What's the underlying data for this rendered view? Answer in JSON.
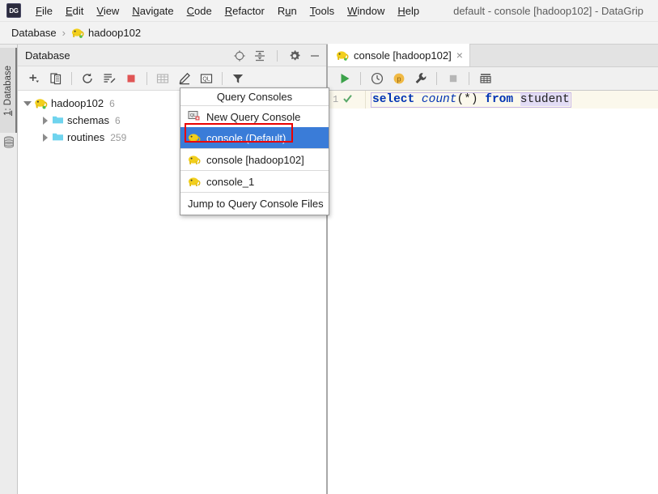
{
  "window": {
    "title": "default - console [hadoop102] - DataGrip",
    "logo": "DG"
  },
  "menubar": {
    "items": [
      {
        "label": "File",
        "mnemonic": "F"
      },
      {
        "label": "Edit",
        "mnemonic": "E"
      },
      {
        "label": "View",
        "mnemonic": "V"
      },
      {
        "label": "Navigate",
        "mnemonic": "N"
      },
      {
        "label": "Code",
        "mnemonic": "C"
      },
      {
        "label": "Refactor",
        "mnemonic": "R"
      },
      {
        "label": "Run",
        "mnemonic": "n"
      },
      {
        "label": "Tools",
        "mnemonic": "T"
      },
      {
        "label": "Window",
        "mnemonic": "W"
      },
      {
        "label": "Help",
        "mnemonic": "H"
      }
    ]
  },
  "breadcrumb": {
    "root": "Database",
    "separator": "›",
    "current": "hadoop102"
  },
  "stripe": {
    "tool_window_label": "1: Database",
    "tool_window_number": "1",
    "db_icon": "database-cylinder-icon"
  },
  "database_panel": {
    "title": "Database",
    "header_actions": [
      {
        "name": "locate-icon",
        "tooltip": "Scroll from Source"
      },
      {
        "name": "collapse-all-icon",
        "tooltip": "Collapse All"
      },
      {
        "name": "gear-icon",
        "tooltip": "Settings"
      },
      {
        "name": "minimize-icon",
        "tooltip": "Hide"
      }
    ],
    "toolbar": [
      {
        "name": "add-icon",
        "tooltip": "New"
      },
      {
        "name": "duplicate-icon",
        "tooltip": "Duplicate"
      },
      {
        "name": "refresh-icon",
        "tooltip": "Refresh"
      },
      {
        "name": "synchronize-icon",
        "tooltip": "Run Script"
      },
      {
        "name": "stop-icon",
        "tooltip": "Stop"
      },
      {
        "name": "table-icon",
        "tooltip": "Open Table Editor"
      },
      {
        "name": "edit-icon",
        "tooltip": "Modify"
      },
      {
        "name": "query-language-icon",
        "tooltip": "QL Console"
      },
      {
        "name": "filter-icon",
        "tooltip": "Filter"
      }
    ],
    "tree": [
      {
        "label": "hadoop102",
        "count": "6",
        "icon": "hive-elephant-icon",
        "expanded": true,
        "level": 0
      },
      {
        "label": "schemas",
        "count": "6",
        "icon": "folder-icon",
        "expanded": false,
        "level": 1
      },
      {
        "label": "routines",
        "count": "259",
        "icon": "folder-icon",
        "expanded": false,
        "level": 1
      }
    ]
  },
  "popup_menu": {
    "title": "Query Consoles",
    "items": [
      {
        "label": "New Query Console",
        "icon": "new-query-console-icon",
        "selected": false
      },
      {
        "label": "console (Default)",
        "icon": "hive-elephant-icon",
        "selected": true
      },
      {
        "label": "console [hadoop102]",
        "icon": "hive-elephant-icon",
        "selected": false
      },
      {
        "label": "console_1",
        "icon": "hive-elephant-icon",
        "selected": false
      }
    ],
    "footer_item": "Jump to Query Console Files",
    "selection_color": "#3a7cd8",
    "highlight_box_color": "#ea0000"
  },
  "editor": {
    "tab": {
      "label": "console [hadoop102]",
      "icon": "hive-elephant-icon",
      "close": "×"
    },
    "toolbar": [
      {
        "name": "run-icon",
        "tooltip": "Execute"
      },
      {
        "name": "history-icon",
        "tooltip": "History"
      },
      {
        "name": "postgres-schema-icon",
        "tooltip": "Schema",
        "badge": "p"
      },
      {
        "name": "wrench-icon",
        "tooltip": "Session Options"
      },
      {
        "name": "stop-icon",
        "tooltip": "Stop"
      },
      {
        "name": "data-output-icon",
        "tooltip": "Show Output"
      }
    ],
    "gutter": {
      "line_number": "1",
      "status_icon": "checkmark-icon"
    },
    "code": {
      "full_text": "select count(*) from student",
      "tokens": [
        {
          "text": "select",
          "type": "keyword"
        },
        {
          "text": " ",
          "type": "plain"
        },
        {
          "text": "count",
          "type": "function"
        },
        {
          "text": "(*)",
          "type": "punct"
        },
        {
          "text": " ",
          "type": "plain"
        },
        {
          "text": "from",
          "type": "keyword"
        },
        {
          "text": " ",
          "type": "plain"
        },
        {
          "text": "student",
          "type": "table"
        }
      ]
    }
  },
  "colors": {
    "keyword": "#0033b3",
    "selection_blue": "#3a7cd8",
    "highlight_red": "#ea0000",
    "current_line": "#fbf8ec",
    "table_highlight": "#e2dcf5",
    "stop_red": "#e05555",
    "run_green": "#3ca24a"
  }
}
